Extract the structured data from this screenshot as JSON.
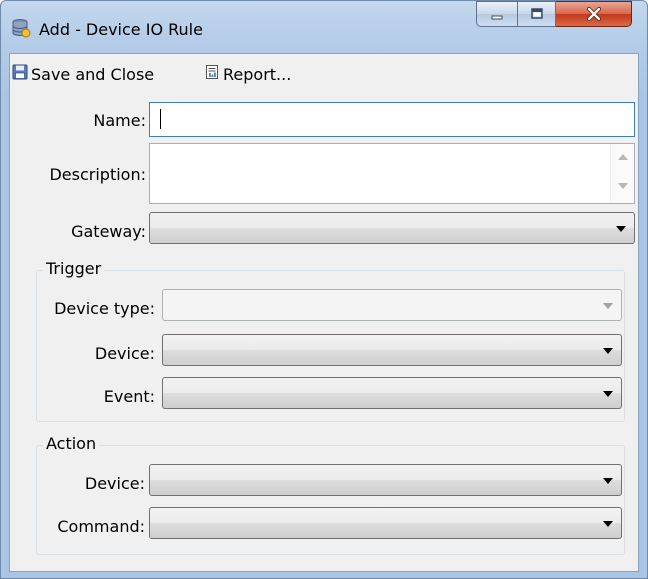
{
  "window": {
    "title": "Add - Device IO Rule",
    "icon": "database-rule-icon"
  },
  "caption_buttons": {
    "minimize": "minimize-icon",
    "maximize": "maximize-icon",
    "close": "close-icon"
  },
  "toolbar": {
    "save_close_label": "Save and Close",
    "report_label": "Report..."
  },
  "form": {
    "name_label": "Name:",
    "name_value": "",
    "description_label": "Description:",
    "description_value": "",
    "gateway_label": "Gateway:",
    "gateway_value": ""
  },
  "trigger": {
    "title": "Trigger",
    "device_type_label": "Device type:",
    "device_type_value": "",
    "device_label": "Device:",
    "device_value": "",
    "event_label": "Event:",
    "event_value": ""
  },
  "action": {
    "title": "Action",
    "device_label": "Device:",
    "device_value": "",
    "command_label": "Command:",
    "command_value": ""
  }
}
